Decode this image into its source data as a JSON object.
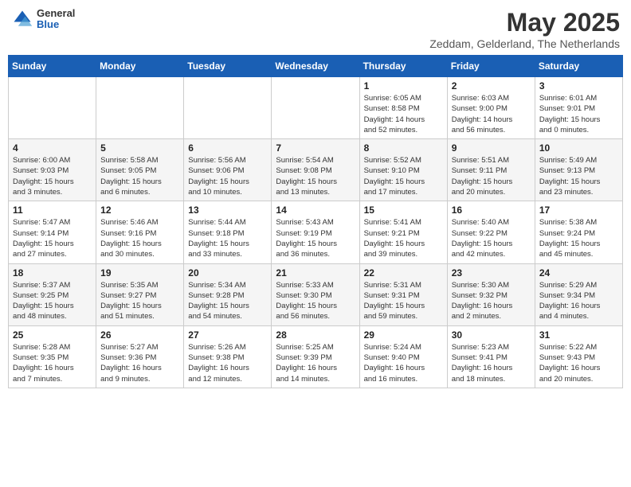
{
  "header": {
    "logo_general": "General",
    "logo_blue": "Blue",
    "month": "May 2025",
    "location": "Zeddam, Gelderland, The Netherlands"
  },
  "weekdays": [
    "Sunday",
    "Monday",
    "Tuesday",
    "Wednesday",
    "Thursday",
    "Friday",
    "Saturday"
  ],
  "weeks": [
    [
      {
        "day": "",
        "info": ""
      },
      {
        "day": "",
        "info": ""
      },
      {
        "day": "",
        "info": ""
      },
      {
        "day": "",
        "info": ""
      },
      {
        "day": "1",
        "info": "Sunrise: 6:05 AM\nSunset: 8:58 PM\nDaylight: 14 hours\nand 52 minutes."
      },
      {
        "day": "2",
        "info": "Sunrise: 6:03 AM\nSunset: 9:00 PM\nDaylight: 14 hours\nand 56 minutes."
      },
      {
        "day": "3",
        "info": "Sunrise: 6:01 AM\nSunset: 9:01 PM\nDaylight: 15 hours\nand 0 minutes."
      }
    ],
    [
      {
        "day": "4",
        "info": "Sunrise: 6:00 AM\nSunset: 9:03 PM\nDaylight: 15 hours\nand 3 minutes."
      },
      {
        "day": "5",
        "info": "Sunrise: 5:58 AM\nSunset: 9:05 PM\nDaylight: 15 hours\nand 6 minutes."
      },
      {
        "day": "6",
        "info": "Sunrise: 5:56 AM\nSunset: 9:06 PM\nDaylight: 15 hours\nand 10 minutes."
      },
      {
        "day": "7",
        "info": "Sunrise: 5:54 AM\nSunset: 9:08 PM\nDaylight: 15 hours\nand 13 minutes."
      },
      {
        "day": "8",
        "info": "Sunrise: 5:52 AM\nSunset: 9:10 PM\nDaylight: 15 hours\nand 17 minutes."
      },
      {
        "day": "9",
        "info": "Sunrise: 5:51 AM\nSunset: 9:11 PM\nDaylight: 15 hours\nand 20 minutes."
      },
      {
        "day": "10",
        "info": "Sunrise: 5:49 AM\nSunset: 9:13 PM\nDaylight: 15 hours\nand 23 minutes."
      }
    ],
    [
      {
        "day": "11",
        "info": "Sunrise: 5:47 AM\nSunset: 9:14 PM\nDaylight: 15 hours\nand 27 minutes."
      },
      {
        "day": "12",
        "info": "Sunrise: 5:46 AM\nSunset: 9:16 PM\nDaylight: 15 hours\nand 30 minutes."
      },
      {
        "day": "13",
        "info": "Sunrise: 5:44 AM\nSunset: 9:18 PM\nDaylight: 15 hours\nand 33 minutes."
      },
      {
        "day": "14",
        "info": "Sunrise: 5:43 AM\nSunset: 9:19 PM\nDaylight: 15 hours\nand 36 minutes."
      },
      {
        "day": "15",
        "info": "Sunrise: 5:41 AM\nSunset: 9:21 PM\nDaylight: 15 hours\nand 39 minutes."
      },
      {
        "day": "16",
        "info": "Sunrise: 5:40 AM\nSunset: 9:22 PM\nDaylight: 15 hours\nand 42 minutes."
      },
      {
        "day": "17",
        "info": "Sunrise: 5:38 AM\nSunset: 9:24 PM\nDaylight: 15 hours\nand 45 minutes."
      }
    ],
    [
      {
        "day": "18",
        "info": "Sunrise: 5:37 AM\nSunset: 9:25 PM\nDaylight: 15 hours\nand 48 minutes."
      },
      {
        "day": "19",
        "info": "Sunrise: 5:35 AM\nSunset: 9:27 PM\nDaylight: 15 hours\nand 51 minutes."
      },
      {
        "day": "20",
        "info": "Sunrise: 5:34 AM\nSunset: 9:28 PM\nDaylight: 15 hours\nand 54 minutes."
      },
      {
        "day": "21",
        "info": "Sunrise: 5:33 AM\nSunset: 9:30 PM\nDaylight: 15 hours\nand 56 minutes."
      },
      {
        "day": "22",
        "info": "Sunrise: 5:31 AM\nSunset: 9:31 PM\nDaylight: 15 hours\nand 59 minutes."
      },
      {
        "day": "23",
        "info": "Sunrise: 5:30 AM\nSunset: 9:32 PM\nDaylight: 16 hours\nand 2 minutes."
      },
      {
        "day": "24",
        "info": "Sunrise: 5:29 AM\nSunset: 9:34 PM\nDaylight: 16 hours\nand 4 minutes."
      }
    ],
    [
      {
        "day": "25",
        "info": "Sunrise: 5:28 AM\nSunset: 9:35 PM\nDaylight: 16 hours\nand 7 minutes."
      },
      {
        "day": "26",
        "info": "Sunrise: 5:27 AM\nSunset: 9:36 PM\nDaylight: 16 hours\nand 9 minutes."
      },
      {
        "day": "27",
        "info": "Sunrise: 5:26 AM\nSunset: 9:38 PM\nDaylight: 16 hours\nand 12 minutes."
      },
      {
        "day": "28",
        "info": "Sunrise: 5:25 AM\nSunset: 9:39 PM\nDaylight: 16 hours\nand 14 minutes."
      },
      {
        "day": "29",
        "info": "Sunrise: 5:24 AM\nSunset: 9:40 PM\nDaylight: 16 hours\nand 16 minutes."
      },
      {
        "day": "30",
        "info": "Sunrise: 5:23 AM\nSunset: 9:41 PM\nDaylight: 16 hours\nand 18 minutes."
      },
      {
        "day": "31",
        "info": "Sunrise: 5:22 AM\nSunset: 9:43 PM\nDaylight: 16 hours\nand 20 minutes."
      }
    ]
  ]
}
